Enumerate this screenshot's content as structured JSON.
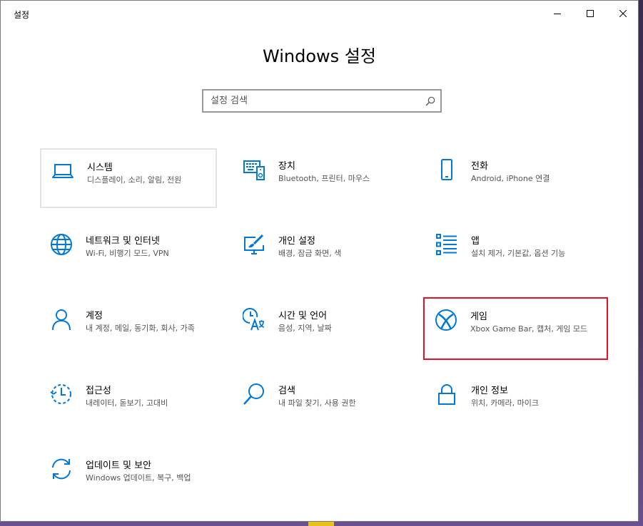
{
  "window": {
    "title": "설정"
  },
  "heading": "Windows 설정",
  "search": {
    "placeholder": "설정 검색",
    "value": ""
  },
  "accent_color": "#0078d7",
  "highlight_color": "#e81123",
  "tiles": [
    {
      "title": "시스템",
      "desc": "디스플레이, 소리, 알림, 전원",
      "icon": "laptop-icon"
    },
    {
      "title": "장치",
      "desc": "Bluetooth, 프린터, 마우스",
      "icon": "devices-icon"
    },
    {
      "title": "전화",
      "desc": "Android, iPhone 연결",
      "icon": "phone-icon"
    },
    {
      "title": "네트워크 및 인터넷",
      "desc": "Wi-Fi, 비행기 모드, VPN",
      "icon": "globe-icon"
    },
    {
      "title": "개인 설정",
      "desc": "배경, 잠금 화면, 색",
      "icon": "paint-icon"
    },
    {
      "title": "앱",
      "desc": "설치 제거, 기본값, 옵션 기능",
      "icon": "apps-list-icon"
    },
    {
      "title": "계정",
      "desc": "내 계정, 메일, 동기화, 회사, 가족",
      "icon": "person-icon"
    },
    {
      "title": "시간 및 언어",
      "desc": "음성, 지역, 날짜",
      "icon": "time-language-icon"
    },
    {
      "title": "게임",
      "desc": "Xbox Game Bar, 캡처, 게임 모드",
      "icon": "xbox-icon"
    },
    {
      "title": "접근성",
      "desc": "내레이터, 돋보기, 고대비",
      "icon": "ease-of-access-icon"
    },
    {
      "title": "검색",
      "desc": "내 파일 찾기, 사용 권한",
      "icon": "magnifier-icon"
    },
    {
      "title": "개인 정보",
      "desc": "위치, 카메라, 마이크",
      "icon": "lock-icon"
    },
    {
      "title": "업데이트 및 보안",
      "desc": "Windows 업데이트, 복구, 백업",
      "icon": "update-sync-icon"
    }
  ]
}
